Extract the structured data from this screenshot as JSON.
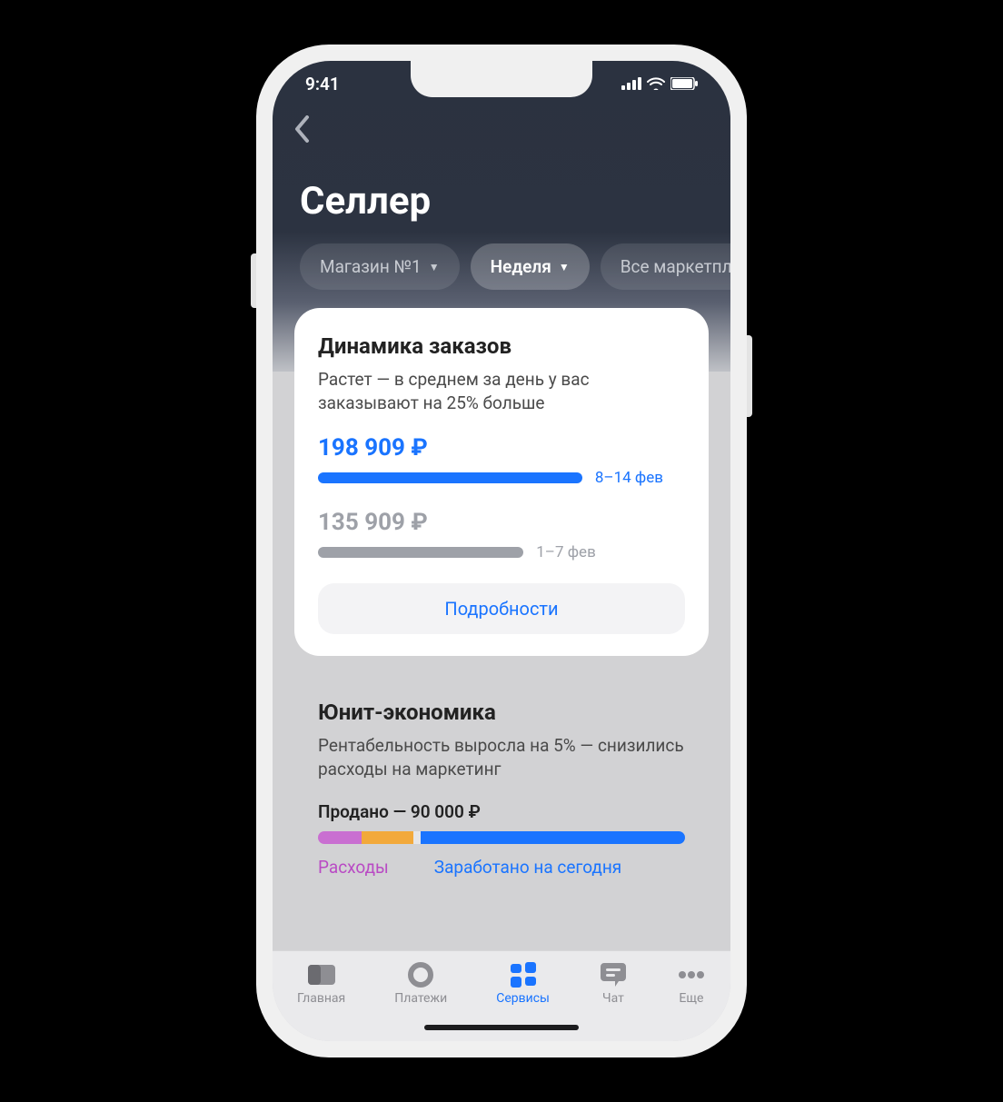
{
  "status": {
    "time": "9:41"
  },
  "header": {
    "title": "Селлер",
    "filters": [
      {
        "label": "Магазин №1",
        "caret": true,
        "active": false
      },
      {
        "label": "Неделя",
        "caret": true,
        "active": true
      },
      {
        "label": "Все маркетплей",
        "caret": false,
        "active": false
      }
    ]
  },
  "orders_card": {
    "title": "Динамика заказов",
    "subtitle": "Растет — в среднем за день у вас заказывают на 25% больше",
    "current": {
      "value": "198 909 ₽",
      "range": "8–14 фев"
    },
    "previous": {
      "value": "135 909 ₽",
      "range": "1–7 фев"
    },
    "details_label": "Подробности"
  },
  "unit_card": {
    "title": "Юнит-экономика",
    "subtitle": "Рентабельность выросла на 5% — снизились расходы на маркетинг",
    "sold_line": "Продано — 90 000 ₽",
    "legend": {
      "expenses": "Расходы",
      "earned": "Заработано на сегодня"
    }
  },
  "tabs": {
    "home": "Главная",
    "payments": "Платежи",
    "services": "Сервисы",
    "chat": "Чат",
    "more": "Еще"
  },
  "chart_data": [
    {
      "type": "bar",
      "title": "Динамика заказов",
      "categories": [
        "8–14 фев",
        "1–7 фев"
      ],
      "values": [
        198909,
        135909
      ],
      "unit": "₽"
    },
    {
      "type": "bar",
      "title": "Юнит-экономика",
      "total_label": "Продано",
      "total_value": 90000,
      "unit": "₽",
      "series": [
        {
          "name": "Расходы",
          "share_pct_est": 26
        },
        {
          "name": "Заработано на сегодня",
          "share_pct_est": 72
        }
      ]
    }
  ]
}
